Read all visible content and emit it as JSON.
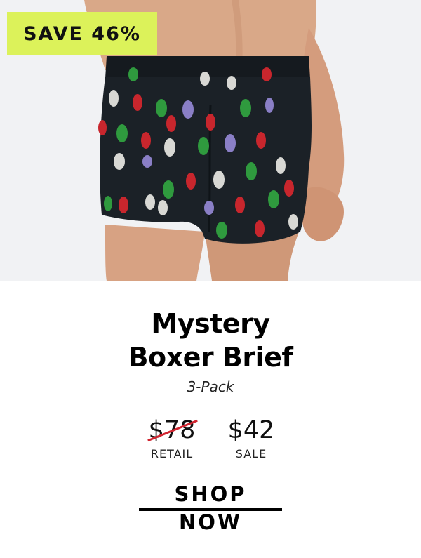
{
  "promo": {
    "badge_text": "SAVE 46%"
  },
  "product": {
    "title_line1": "Mystery",
    "title_line2": "Boxer Brief",
    "pack": "3-Pack"
  },
  "pricing": {
    "retail_price": "$78",
    "retail_label": "RETAIL",
    "sale_price": "$42",
    "sale_label": "SALE",
    "strike_color": "#d1242f"
  },
  "cta": {
    "label": "SHOP NOW"
  },
  "colors": {
    "badge_bg": "#dcf25a",
    "hero_bg": "#f1f2f4",
    "fabric": "#1b2127",
    "bulbs": [
      "#c8262d",
      "#2f9a3e",
      "#8a7fc6",
      "#d8d8d4"
    ]
  }
}
